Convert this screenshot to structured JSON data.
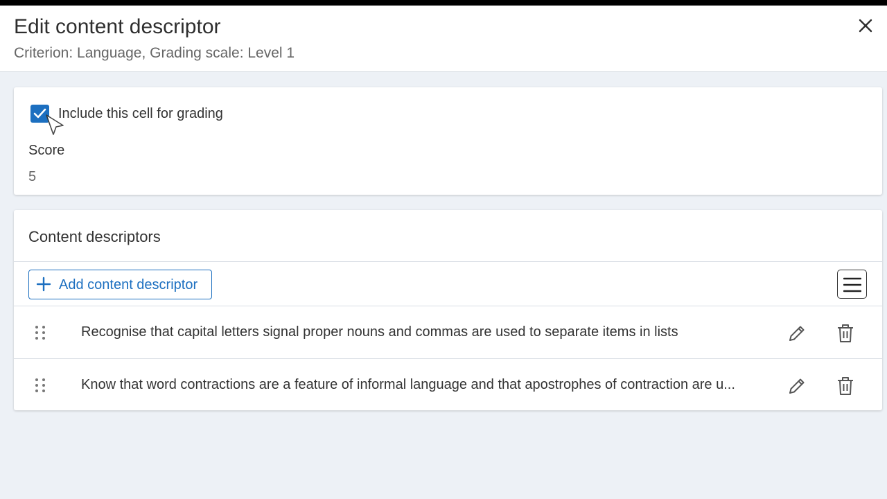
{
  "dialog": {
    "title": "Edit content descriptor",
    "subtitle": "Criterion: Language, Grading scale: Level 1",
    "close_icon": "close-icon"
  },
  "grading": {
    "include_label": "Include this cell for grading",
    "include_checked": true,
    "score_label": "Score",
    "score_value": "5"
  },
  "descriptors": {
    "section_title": "Content descriptors",
    "add_button_label": "Add content descriptor",
    "menu_icon": "hamburger-menu-icon",
    "items": [
      {
        "text": "Recognise that capital letters signal proper nouns and commas are used to separate items in lists"
      },
      {
        "text": "Know that word contractions are a feature of informal language and that apostrophes of contraction are u..."
      }
    ]
  },
  "colors": {
    "accent": "#1c6fc0",
    "background": "#edf1f6"
  }
}
